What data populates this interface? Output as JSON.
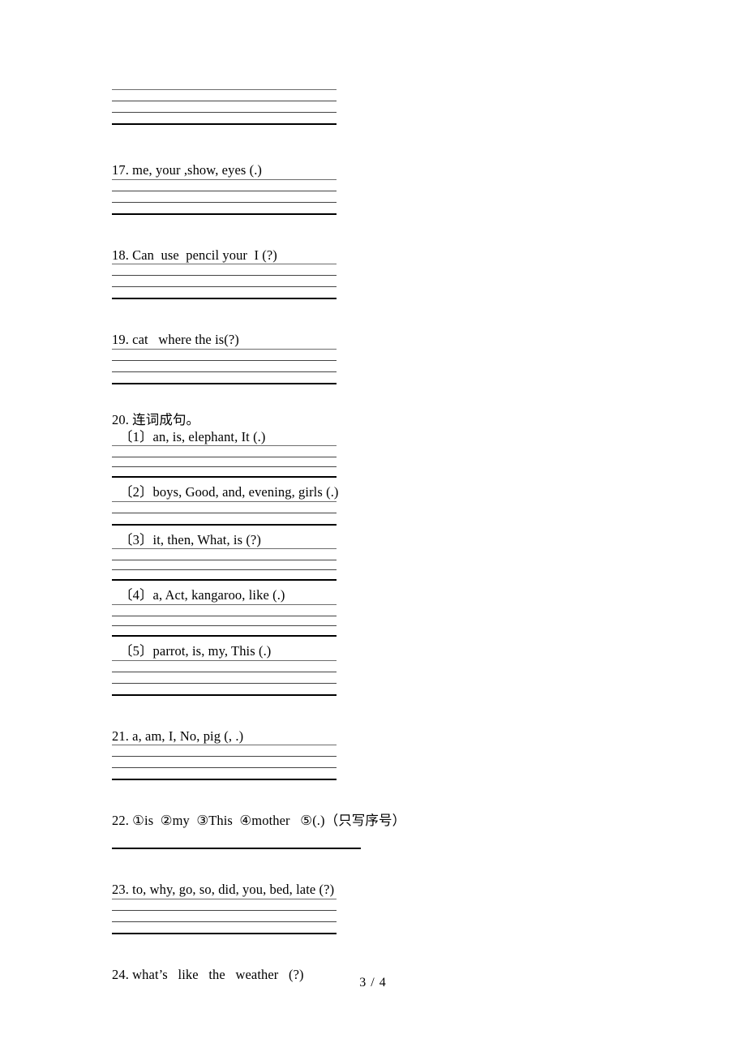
{
  "document": {
    "page_footer": "3 / 4"
  },
  "items": [
    {
      "id": "q17",
      "number": "17.",
      "text": "17. me, your ,show, eyes (.)",
      "lines": 4
    },
    {
      "id": "q18",
      "number": "18.",
      "text": "18. Can  use  pencil your  I (?)",
      "lines": 4
    },
    {
      "id": "q19",
      "number": "19.",
      "text": "19. cat   where the is(?)",
      "lines": 4
    },
    {
      "id": "q20",
      "number": "20.",
      "text": "20. 连词成句。",
      "lines": 0,
      "subitems": [
        {
          "id": "q20-1",
          "text": "〔1〕an, is, elephant, It (.)",
          "lines": 4
        },
        {
          "id": "q20-2",
          "text": "〔2〕boys, Good, and, evening, girls (.)",
          "lines": 3
        },
        {
          "id": "q20-3",
          "text": "〔3〕it, then, What, is (?)",
          "lines": 4
        },
        {
          "id": "q20-4",
          "text": "〔4〕a, Act, kangaroo, like (.)",
          "lines": 4
        },
        {
          "id": "q20-5",
          "text": "〔5〕parrot, is, my, This (.)",
          "lines": 4
        }
      ]
    },
    {
      "id": "q21",
      "number": "21.",
      "text": "21. a, am, I, No, pig (, .)",
      "lines": 4
    },
    {
      "id": "q22",
      "number": "22.",
      "text": "22. ①is  ②my  ③This  ④mother   ⑤(.)（只写序号）",
      "lines": 1
    },
    {
      "id": "q23",
      "number": "23.",
      "text": "23. to, why, go, so, did, you, bed, late (?)",
      "lines": 4
    },
    {
      "id": "q24",
      "number": "24.",
      "text": "24. what’s   like   the   weather   (?)",
      "lines": 0
    }
  ],
  "top_partial_answer_lines": 4
}
